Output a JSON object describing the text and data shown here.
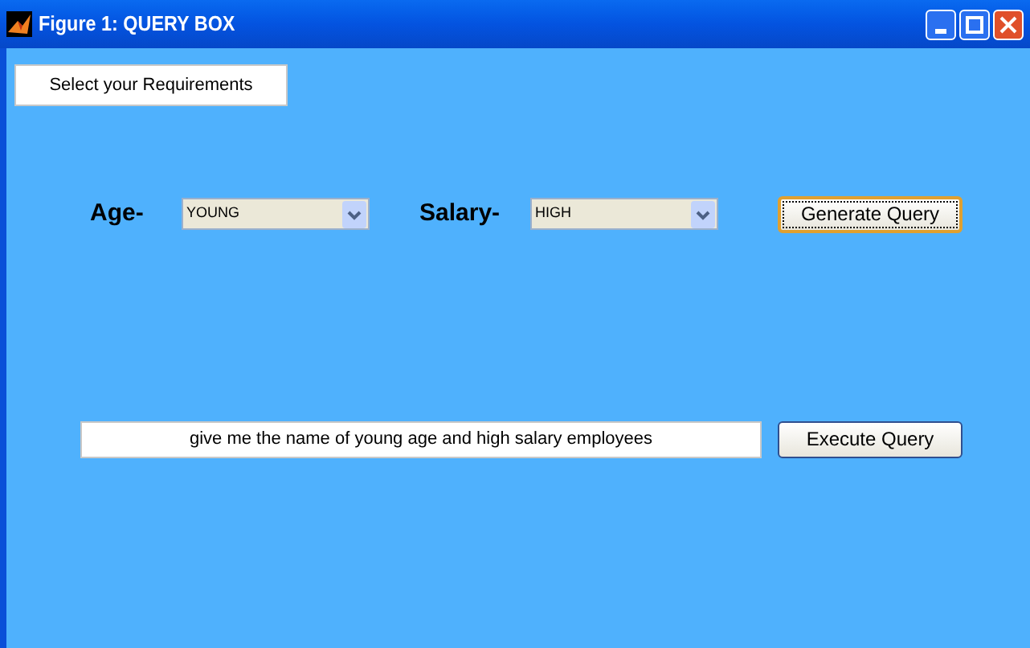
{
  "window": {
    "title": "Figure 1: QUERY BOX"
  },
  "heading": "Select your Requirements",
  "filters": [
    {
      "label": "Age-",
      "value": "YOUNG"
    },
    {
      "label": "Salary-",
      "value": "HIGH"
    }
  ],
  "generate_button": {
    "label": "Generate Query",
    "focused": true
  },
  "query_field": {
    "value": "give me the name of young age and high salary employees"
  },
  "execute_button": {
    "label": "Execute Query",
    "focused": false
  }
}
